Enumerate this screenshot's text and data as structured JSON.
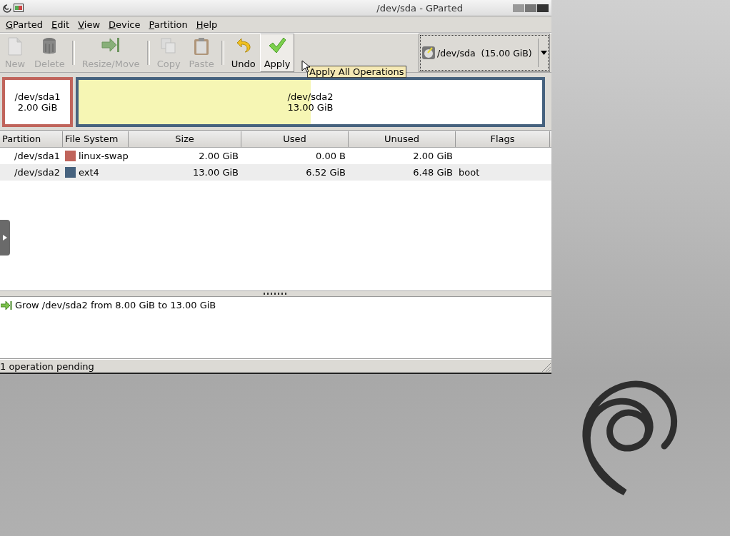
{
  "window": {
    "title": "/dev/sda - GParted"
  },
  "menu": [
    "GParted",
    "Edit",
    "View",
    "Device",
    "Partition",
    "Help"
  ],
  "toolbar": [
    {
      "kind": "new",
      "label": "New",
      "disabled": true
    },
    {
      "kind": "delete",
      "label": "Delete",
      "disabled": true
    },
    {
      "kind": "separator"
    },
    {
      "kind": "resize",
      "label": "Resize/Move",
      "disabled": true
    },
    {
      "kind": "separator"
    },
    {
      "kind": "copy",
      "label": "Copy",
      "disabled": true
    },
    {
      "kind": "paste",
      "label": "Paste",
      "disabled": true
    },
    {
      "kind": "separator"
    },
    {
      "kind": "undo",
      "label": "Undo",
      "disabled": false
    },
    {
      "kind": "apply",
      "label": "Apply",
      "disabled": false
    }
  ],
  "tooltip": "Apply All Operations",
  "device_selector": {
    "label": "/dev/sda  (15.00 GiB)"
  },
  "partition_map": [
    {
      "name": "/dev/sda1",
      "size": "2.00 GiB",
      "color": "#c0645b",
      "level": 0
    },
    {
      "name": "/dev/sda2",
      "size": "13.00 GiB",
      "color": "#46627e",
      "level": 0.5
    }
  ],
  "table": {
    "columns": [
      "Partition",
      "File System",
      "Size",
      "Used",
      "Unused",
      "Flags"
    ],
    "rows": [
      {
        "partition": "/dev/sda1",
        "file_system": "linux-swap",
        "color": "#c0645b",
        "size": "2.00 GiB",
        "used": "0.00 B",
        "unused": "2.00 GiB"
      },
      {
        "partition": "/dev/sda2",
        "file_system": "ext4",
        "color": "#46627e",
        "size": "13.00 GiB",
        "used": "6.52 GiB",
        "unused": "6.48 GiB",
        "flags": "boot"
      }
    ]
  },
  "operations": [
    {
      "text": "Grow /dev/sda2 from 8.00 GiB to 13.00 GiB"
    }
  ],
  "status_bar": "1 operation pending"
}
